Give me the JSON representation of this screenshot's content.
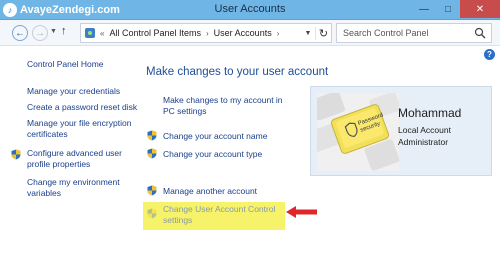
{
  "watermark": {
    "text": "AvayeZendegi.com",
    "icon": "speaker-icon"
  },
  "window": {
    "title": "User Accounts",
    "controls": [
      "minimize-icon",
      "maximize-icon",
      "close-icon"
    ]
  },
  "nav": {
    "breadcrumb_prefix": "«",
    "crumbs": [
      "All Control Panel Items",
      "User Accounts"
    ],
    "search_placeholder": "Search Control Panel"
  },
  "sidebar": {
    "items": [
      {
        "label": "Control Panel Home"
      },
      {
        "label": "Manage your credentials"
      },
      {
        "label": "Create a password reset disk"
      },
      {
        "label_1": "Manage your file encryption",
        "label_2": "certificates"
      },
      {
        "label_1": "Configure advanced user",
        "label_2": "profile properties",
        "icon": "shield-icon"
      },
      {
        "label_1": "Change my environment",
        "label_2": "variables"
      }
    ]
  },
  "main": {
    "title": "Make changes to your user account",
    "links": [
      {
        "label_1": "Make changes to my account in",
        "label_2": "PC settings"
      },
      {
        "label": "Change your account name",
        "icon": "shield-icon"
      },
      {
        "label": "Change your account type",
        "icon": "shield-icon"
      },
      {
        "label": "Manage another account",
        "icon": "shield-icon"
      },
      {
        "label_1": "Change User Account Control",
        "label_2": "settings",
        "icon": "shield-icon",
        "highlighted": true
      }
    ]
  },
  "account": {
    "name": "Mohammad",
    "type": "Local Account",
    "role": "Administrator",
    "avatar_key_text_1": "Password",
    "avatar_key_text_2": "security"
  },
  "colors": {
    "titlebar": "#6fb6e6",
    "link": "#1a3f8c",
    "title": "#1e4f94",
    "highlight": "#f6f36a",
    "arrow": "#e0262b"
  }
}
